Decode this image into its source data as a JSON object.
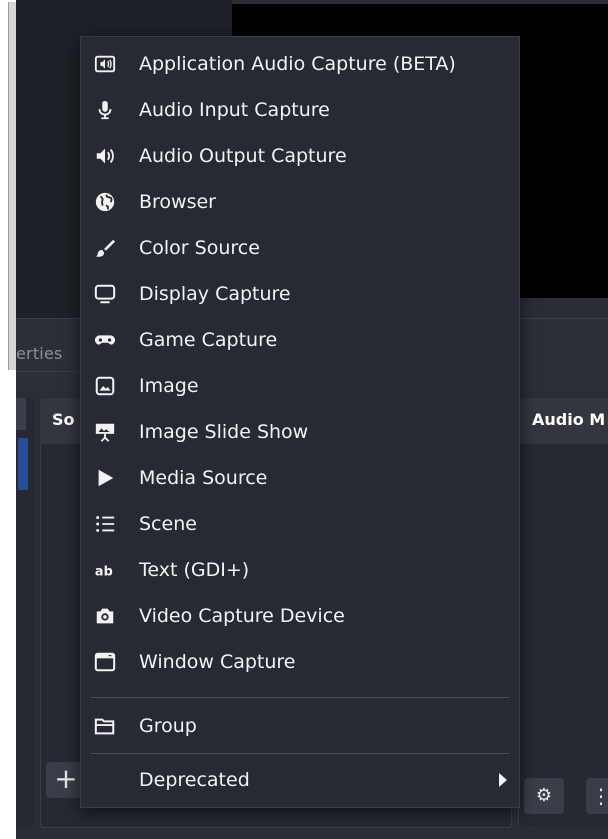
{
  "tabs": {
    "properties_fragment": "erties"
  },
  "docks": {
    "sources_title": "So",
    "audio_title": "Audio M",
    "add_label": "+"
  },
  "menu": {
    "items": [
      {
        "label": "Application Audio Capture (BETA)",
        "icon": "app-audio-icon"
      },
      {
        "label": "Audio Input Capture",
        "icon": "microphone-icon"
      },
      {
        "label": "Audio Output Capture",
        "icon": "speaker-icon"
      },
      {
        "label": "Browser",
        "icon": "globe-icon"
      },
      {
        "label": "Color Source",
        "icon": "paintbrush-icon"
      },
      {
        "label": "Display Capture",
        "icon": "monitor-icon"
      },
      {
        "label": "Game Capture",
        "icon": "gamepad-icon"
      },
      {
        "label": "Image",
        "icon": "image-icon"
      },
      {
        "label": "Image Slide Show",
        "icon": "slideshow-icon"
      },
      {
        "label": "Media Source",
        "icon": "play-icon"
      },
      {
        "label": "Scene",
        "icon": "list-icon"
      },
      {
        "label": "Text (GDI+)",
        "icon": "text-icon"
      },
      {
        "label": "Video Capture Device",
        "icon": "camera-icon"
      },
      {
        "label": "Window Capture",
        "icon": "window-icon"
      }
    ],
    "group": {
      "label": "Group",
      "icon": "folder-icon"
    },
    "deprecated": {
      "label": "Deprecated",
      "icon": "chevron-right-icon"
    }
  },
  "colors": {
    "menu_bg": "#272a33",
    "app_bg": "#2a2d35",
    "selected_scene": "#284c9a",
    "text": "#f2f2f2"
  }
}
